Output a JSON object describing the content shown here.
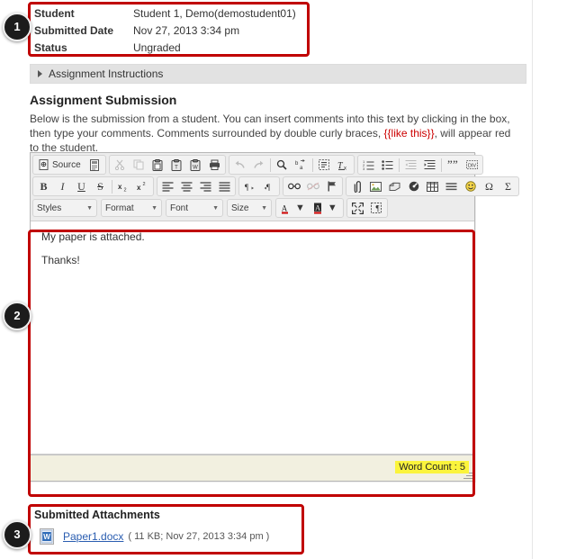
{
  "header": {
    "rows": [
      {
        "label": "Student",
        "value": "Student 1, Demo(demostudent01)"
      },
      {
        "label": "Submitted Date",
        "value": "Nov 27, 2013 3:34 pm"
      },
      {
        "label": "Status",
        "value": "Ungraded"
      }
    ]
  },
  "instructions": {
    "label": "Assignment Instructions",
    "disclosure_icon": "triangle-right-icon",
    "expanded": false
  },
  "submission": {
    "title": "Assignment Submission",
    "desc_part1": "Below is the submission from a student. You can insert comments into this text by clicking in the box, then type your comments. Comments surrounded by double curly braces, ",
    "desc_highlight": "{{like this}}",
    "desc_part2": ", will appear red to the student.",
    "highlight_color": "#cc0000"
  },
  "editor": {
    "toolbar_row1": [
      {
        "name": "source-button",
        "label": "Source",
        "icon": "source-icon",
        "disabled": false,
        "group": 1
      },
      {
        "name": "templates-button",
        "label": "",
        "icon": "templates-icon",
        "disabled": false,
        "group": 1
      },
      {
        "name": "cut-button",
        "label": "",
        "icon": "scissors-icon",
        "disabled": true,
        "group": 2
      },
      {
        "name": "copy-button",
        "label": "",
        "icon": "copy-icon",
        "disabled": true,
        "group": 2
      },
      {
        "name": "paste-button",
        "label": "",
        "icon": "clipboard-icon",
        "disabled": false,
        "group": 2
      },
      {
        "name": "paste-text-button",
        "label": "",
        "icon": "paste-text-icon",
        "disabled": false,
        "group": 2
      },
      {
        "name": "paste-word-button",
        "label": "",
        "icon": "paste-word-icon",
        "disabled": false,
        "group": 2
      },
      {
        "name": "print-button",
        "label": "",
        "icon": "printer-icon",
        "disabled": false,
        "group": 2
      },
      {
        "name": "undo-button",
        "label": "",
        "icon": "undo-arrow-icon",
        "disabled": true,
        "group": 3
      },
      {
        "name": "redo-button",
        "label": "",
        "icon": "redo-arrow-icon",
        "disabled": true,
        "group": 3
      },
      {
        "name": "find-button",
        "label": "",
        "icon": "magnifier-icon",
        "disabled": false,
        "group": 3
      },
      {
        "name": "replace-button",
        "label": "",
        "icon": "replace-icon",
        "disabled": false,
        "group": 3
      },
      {
        "name": "select-all-button",
        "label": "",
        "icon": "select-all-icon",
        "disabled": false,
        "group": 3
      },
      {
        "name": "remove-format-button",
        "label": "",
        "icon": "remove-format-icon",
        "disabled": false,
        "group": 3
      },
      {
        "name": "numbered-list-button",
        "label": "",
        "icon": "numbered-list-icon",
        "disabled": false,
        "group": 4
      },
      {
        "name": "bulleted-list-button",
        "label": "",
        "icon": "bulleted-list-icon",
        "disabled": false,
        "group": 4
      },
      {
        "name": "outdent-button",
        "label": "",
        "icon": "outdent-icon",
        "disabled": true,
        "group": 4
      },
      {
        "name": "indent-button",
        "label": "",
        "icon": "indent-icon",
        "disabled": false,
        "group": 4
      },
      {
        "name": "blockquote-button",
        "label": "",
        "icon": "quote-icon",
        "disabled": false,
        "group": 4
      },
      {
        "name": "create-div-button",
        "label": "",
        "icon": "create-div-icon",
        "disabled": false,
        "group": 4
      }
    ],
    "toolbar_row2": [
      {
        "name": "bold-button",
        "label": "B",
        "icon": "bold-icon",
        "disabled": false,
        "group": 1
      },
      {
        "name": "italic-button",
        "label": "I",
        "icon": "italic-icon",
        "disabled": false,
        "group": 1
      },
      {
        "name": "underline-button",
        "label": "U",
        "icon": "underline-icon",
        "disabled": false,
        "group": 1
      },
      {
        "name": "strikethrough-button",
        "label": "S",
        "icon": "strikethrough-icon",
        "disabled": false,
        "group": 1
      },
      {
        "name": "subscript-button",
        "label": "x",
        "icon": "subscript-icon",
        "disabled": false,
        "group": 1
      },
      {
        "name": "superscript-button",
        "label": "x",
        "icon": "superscript-icon",
        "disabled": false,
        "group": 1
      },
      {
        "name": "align-left-button",
        "label": "",
        "icon": "align-left-icon",
        "disabled": false,
        "group": 2
      },
      {
        "name": "align-center-button",
        "label": "",
        "icon": "align-center-icon",
        "disabled": false,
        "group": 2
      },
      {
        "name": "align-right-button",
        "label": "",
        "icon": "align-right-icon",
        "disabled": false,
        "group": 2
      },
      {
        "name": "justify-button",
        "label": "",
        "icon": "align-justify-icon",
        "disabled": false,
        "group": 2
      },
      {
        "name": "text-direction-ltr-button",
        "label": "",
        "icon": "direction-ltr-icon",
        "disabled": false,
        "group": 3
      },
      {
        "name": "text-direction-rtl-button",
        "label": "",
        "icon": "direction-rtl-icon",
        "disabled": false,
        "group": 3
      },
      {
        "name": "link-button",
        "label": "",
        "icon": "link-icon",
        "disabled": false,
        "group": 4
      },
      {
        "name": "unlink-button",
        "label": "",
        "icon": "unlink-icon",
        "disabled": true,
        "group": 4
      },
      {
        "name": "anchor-button",
        "label": "",
        "icon": "anchor-flag-icon",
        "disabled": false,
        "group": 4
      },
      {
        "name": "insert-file-button",
        "label": "",
        "icon": "attach-file-icon",
        "disabled": false,
        "group": 5
      },
      {
        "name": "insert-image-button",
        "label": "",
        "icon": "image-icon",
        "disabled": false,
        "group": 5
      },
      {
        "name": "insert-flash-button",
        "label": "",
        "icon": "flash-icon",
        "disabled": false,
        "group": 5
      },
      {
        "name": "insert-media-button",
        "label": "",
        "icon": "media-icon",
        "disabled": false,
        "group": 5
      },
      {
        "name": "insert-table-button",
        "label": "",
        "icon": "table-icon",
        "disabled": false,
        "group": 5
      },
      {
        "name": "horizontal-rule-button",
        "label": "",
        "icon": "horizontal-rule-icon",
        "disabled": false,
        "group": 5
      },
      {
        "name": "smiley-button",
        "label": "",
        "icon": "smiley-icon",
        "disabled": false,
        "group": 5
      },
      {
        "name": "special-char-button",
        "label": "Ω",
        "icon": "omega-icon",
        "disabled": false,
        "group": 5
      },
      {
        "name": "math-button",
        "label": "Σ",
        "icon": "sigma-icon",
        "disabled": false,
        "group": 5
      }
    ],
    "toolbar_row3_combos": [
      {
        "name": "styles-select",
        "label": "Styles"
      },
      {
        "name": "format-select",
        "label": "Format"
      },
      {
        "name": "font-select",
        "label": "Font"
      },
      {
        "name": "size-select",
        "label": "Size"
      }
    ],
    "toolbar_row3_buttons": [
      {
        "name": "text-color-button",
        "label": "A",
        "icon": "text-color-icon",
        "disabled": false,
        "group": 1
      },
      {
        "name": "background-color-button",
        "label": "A",
        "icon": "bg-color-icon",
        "disabled": false,
        "group": 1
      },
      {
        "name": "maximize-button",
        "label": "",
        "icon": "maximize-icon",
        "disabled": false,
        "group": 2
      },
      {
        "name": "show-blocks-button",
        "label": "",
        "icon": "show-blocks-icon",
        "disabled": false,
        "group": 2
      }
    ],
    "content": {
      "paragraphs": [
        "My paper is attached.",
        "Thanks!"
      ]
    },
    "footer": {
      "word_count_label": "Word Count : 5",
      "highlight_color": "#fbf43c",
      "resize_grip_icon": "resize-grip-icon"
    }
  },
  "attachments": {
    "title": "Submitted Attachments",
    "items": [
      {
        "icon": "word-document-icon",
        "filename": "Paper1.docx",
        "meta": "( 11 KB; Nov 27, 2013 3:34 pm )"
      }
    ]
  },
  "annotations": {
    "badges": [
      {
        "name": "callout-badge-1",
        "number": "1"
      },
      {
        "name": "callout-badge-2",
        "number": "2"
      },
      {
        "name": "callout-badge-3",
        "number": "3"
      }
    ],
    "box_color": "#c00000"
  }
}
